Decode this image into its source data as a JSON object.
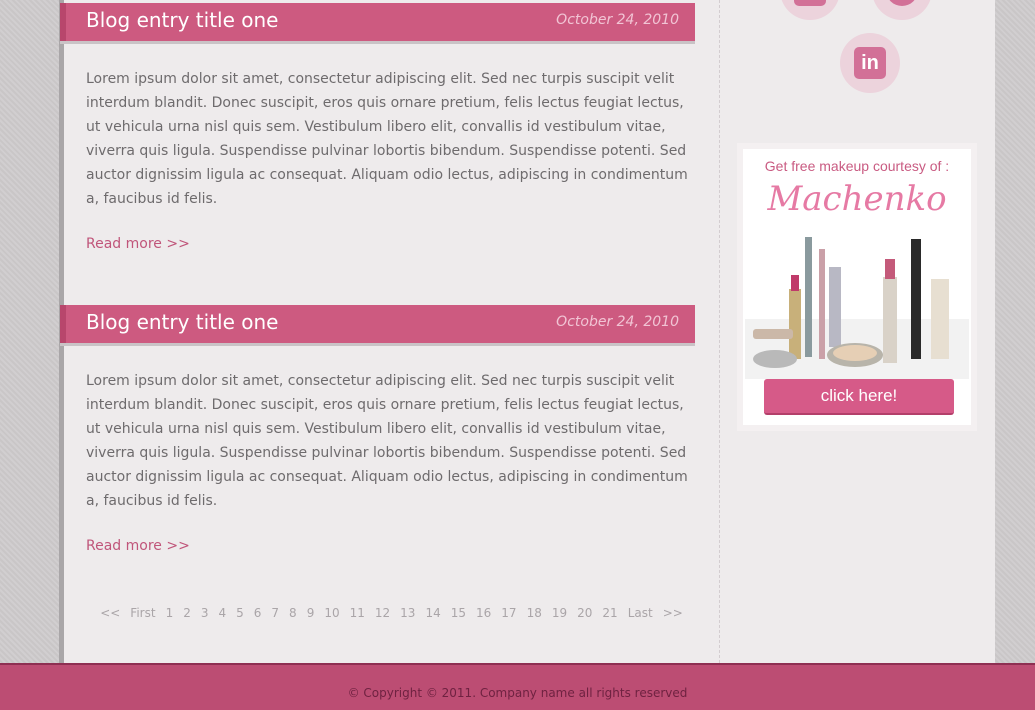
{
  "posts": [
    {
      "title": "Blog entry title one",
      "date": "October 24, 2010",
      "body": "Lorem ipsum dolor sit amet, consectetur adipiscing elit. Sed nec turpis suscipit velit interdum blandit. Donec suscipit, eros quis ornare pretium, felis lectus feugiat lectus, ut vehicula urna nisl quis sem. Vestibulum libero elit, convallis id vestibulum vitae, viverra quis ligula. Suspendisse pulvinar lobortis bibendum. Suspendisse potenti. Sed auctor dignissim ligula ac consequat. Aliquam odio lectus, adipiscing in condimentum a, faucibus id felis.",
      "read_more": "Read more >>"
    },
    {
      "title": "Blog entry title one",
      "date": "October 24, 2010",
      "body": "Lorem ipsum dolor sit amet, consectetur adipiscing elit. Sed nec turpis suscipit velit interdum blandit. Donec suscipit, eros quis ornare pretium, felis lectus feugiat lectus, ut vehicula urna nisl quis sem. Vestibulum libero elit, convallis id vestibulum vitae, viverra quis ligula. Suspendisse pulvinar lobortis bibendum. Suspendisse potenti. Sed auctor dignissim ligula ac consequat. Aliquam odio lectus, adipiscing in condimentum a, faucibus id felis.",
      "read_more": "Read more >>"
    }
  ],
  "pagination": {
    "prev": "<<",
    "first": "First",
    "pages": [
      "1",
      "2",
      "3",
      "4",
      "5",
      "6",
      "7",
      "8",
      "9",
      "10",
      "11",
      "12",
      "13",
      "14",
      "15",
      "16",
      "17",
      "18",
      "19",
      "20",
      "21"
    ],
    "last": "Last",
    "next": ">>"
  },
  "sidebar": {
    "social_icons": [
      "facebook-icon",
      "dribbble-icon",
      "linkedin-icon"
    ],
    "linkedin_glyph": "in",
    "ad": {
      "tagline": "Get free makeup courtesy of :",
      "brand": "Machenko",
      "button": "click here!"
    }
  },
  "footer": {
    "copyright": "© Copyright © 2011. Company name all rights reserved"
  },
  "colors": {
    "accent": "#cd5a80",
    "footer": "#bc4d73",
    "text": "#6e6b6d",
    "link": "#c0557a"
  }
}
